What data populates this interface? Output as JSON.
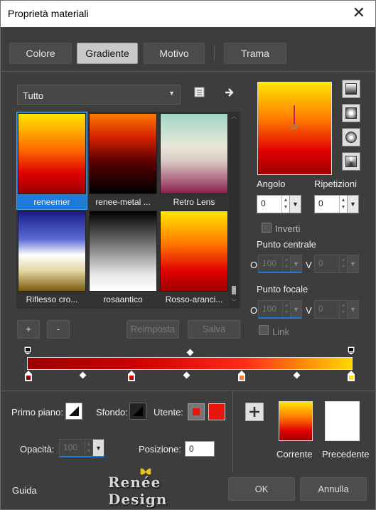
{
  "window": {
    "title": "Proprietà materiali"
  },
  "tabs": [
    {
      "label": "Colore",
      "active": false
    },
    {
      "label": "Gradiente",
      "active": true
    },
    {
      "label": "Motivo",
      "active": false
    },
    {
      "label": "Trama",
      "active": false
    }
  ],
  "category_select": {
    "value": "Tutto"
  },
  "gradients": [
    {
      "name": "reneemer",
      "selected": true
    },
    {
      "name": "renee-metal ...",
      "selected": false
    },
    {
      "name": "Retro Lens",
      "selected": false
    },
    {
      "name": "Riflesso cro...",
      "selected": false
    },
    {
      "name": "rosaantico",
      "selected": false
    },
    {
      "name": "Rosso-aranci...",
      "selected": false
    }
  ],
  "list_buttons": {
    "add": "+",
    "remove": "-",
    "reset": "Reimposta",
    "save": "Salva"
  },
  "angle": {
    "label": "Angolo",
    "value": "0"
  },
  "repeats": {
    "label": "Ripetizioni",
    "value": "0"
  },
  "invert": {
    "label": "Inverti",
    "checked": false
  },
  "center_point": {
    "label": "Punto centrale",
    "o_label": "O",
    "o_value": "100",
    "v_label": "V",
    "v_value": "0"
  },
  "focal_point": {
    "label": "Punto focale",
    "o_label": "O",
    "o_value": "100",
    "v_label": "V",
    "v_value": "0"
  },
  "link": {
    "label": "Link",
    "checked": false
  },
  "gradient_bar": {
    "colors": [
      "#9a0000",
      "#cc0000",
      "#ff2a1a",
      "#ffd800"
    ]
  },
  "foreground": {
    "label": "Primo piano:"
  },
  "background": {
    "label": "Sfondo:"
  },
  "user": {
    "label": "Utente:",
    "color": "#e8140e"
  },
  "opacity": {
    "label": "Opacità:",
    "value": "100"
  },
  "position": {
    "label": "Posizione:",
    "value": "0"
  },
  "current": {
    "label": "Corrente"
  },
  "previous": {
    "label": "Precedente"
  },
  "watermark": {
    "text": "Renée Design"
  },
  "footer": {
    "help": "Guida",
    "ok": "OK",
    "cancel": "Annulla"
  },
  "colors": {
    "accent": "#1e7bd8",
    "dialog_bg": "#3d3d3d",
    "panel_bg": "#333333"
  }
}
